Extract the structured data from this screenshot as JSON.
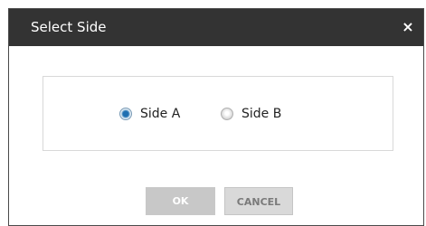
{
  "dialog": {
    "title": "Select Side",
    "close_label": "×",
    "options": [
      {
        "label": "Side A",
        "selected": true
      },
      {
        "label": "Side B",
        "selected": false
      }
    ],
    "ok_label": "OK",
    "cancel_label": "CANCEL"
  },
  "colors": {
    "titlebar": "#333333",
    "radio_selected": "#1f6fb1",
    "button_gray": "#c8c8c8"
  },
  "icons": {
    "close": "close-icon"
  }
}
